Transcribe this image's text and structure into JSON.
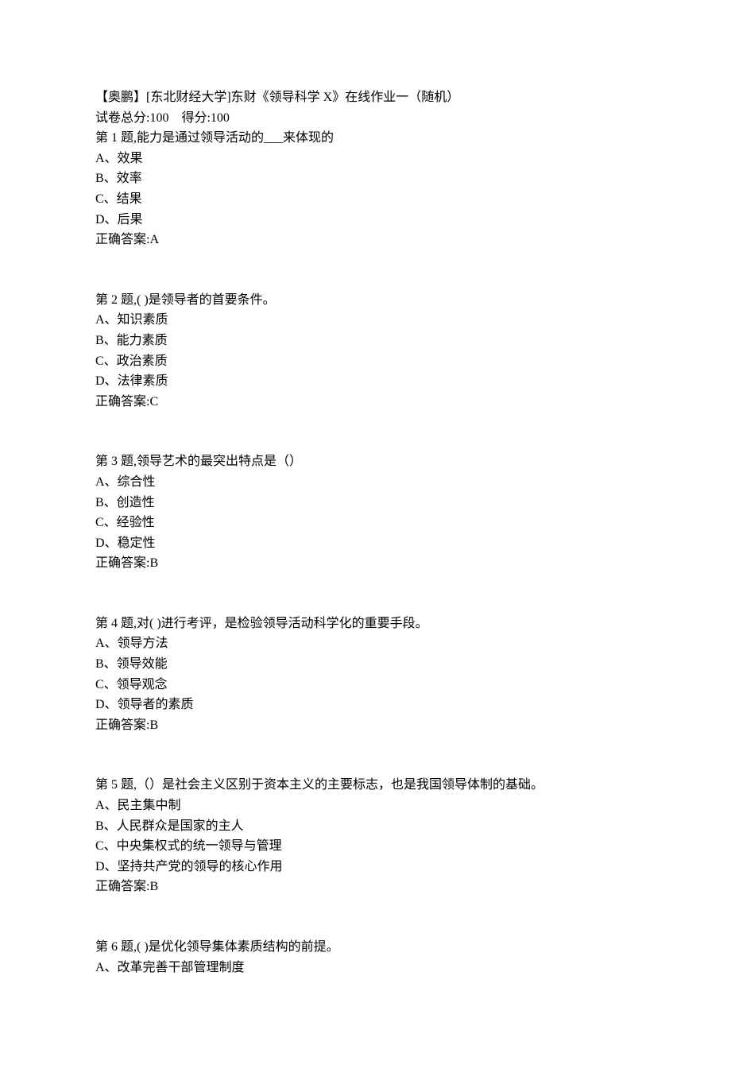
{
  "header": {
    "title": "【奥鹏】[东北财经大学]东财《领导科学 X》在线作业一（随机）",
    "score_line": "试卷总分:100    得分:100"
  },
  "questions": [
    {
      "stem": "第 1 题,能力是通过领导活动的___来体现的",
      "options": [
        "A、效果",
        "B、效率",
        "C、结果",
        "D、后果"
      ],
      "answer": "正确答案:A"
    },
    {
      "stem": "第 2 题,( )是领导者的首要条件。",
      "options": [
        "A、知识素质",
        "B、能力素质",
        "C、政治素质",
        "D、法律素质"
      ],
      "answer": "正确答案:C"
    },
    {
      "stem": "第 3 题,领导艺术的最突出特点是（）",
      "options": [
        "A、综合性",
        "B、创造性",
        "C、经验性",
        "D、稳定性"
      ],
      "answer": "正确答案:B"
    },
    {
      "stem": "第 4 题,对( )进行考评，是检验领导活动科学化的重要手段。",
      "options": [
        "A、领导方法",
        "B、领导效能",
        "C、领导观念",
        "D、领导者的素质"
      ],
      "answer": "正确答案:B"
    },
    {
      "stem": "第 5 题,（）是社会主义区别于资本主义的主要标志，也是我国领导体制的基础。",
      "options": [
        "A、民主集中制",
        "B、人民群众是国家的主人",
        "C、中央集权式的统一领导与管理",
        "D、坚持共产党的领导的核心作用"
      ],
      "answer": "正确答案:B"
    },
    {
      "stem": "第 6 题,( )是优化领导集体素质结构的前提。",
      "options": [
        "A、改革完善干部管理制度"
      ],
      "answer": ""
    }
  ]
}
